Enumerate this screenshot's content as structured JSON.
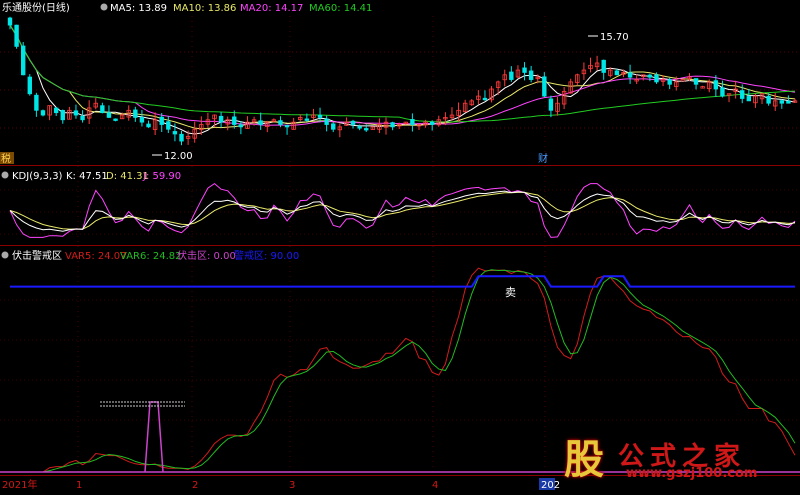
{
  "header": {
    "stock": "乐通股份(日线)",
    "ma5": "MA5: 13.89",
    "ma10": "MA10: 13.86",
    "ma20": "MA20: 14.17",
    "ma60": "MA60: 14.41"
  },
  "kdj": {
    "title": "KDJ(9,3,3)",
    "k": "K: 47.51",
    "d": "D: 41.31",
    "j": "J: 59.90"
  },
  "ambush": {
    "title": "伏击警戒区",
    "var5": "VAR5: 24.07",
    "var6": "VAR6: 24.82",
    "zone": "伏击区: 0.00",
    "alert": "警戒区: 90.00"
  },
  "markers": {
    "high": "15.70",
    "low": "12.00",
    "left_tag": "税",
    "fin_tag": "财",
    "sell": "卖"
  },
  "axis": {
    "labels": [
      "2021年",
      "1",
      "2",
      "3",
      "4",
      "202"
    ]
  },
  "watermark": {
    "glyph": "股",
    "title": "公式之家",
    "url": "www.gszj100.com"
  },
  "colors": {
    "up": "#ff3c3c",
    "down": "#00e5e5",
    "ma5": "#ffffff",
    "ma10": "#e8e86a",
    "ma20": "#ff44ff",
    "ma60": "#22cc22",
    "kdj_k": "#ffffff",
    "kdj_d": "#e8e86a",
    "kdj_j": "#ff44ff",
    "var5": "#d21c1c",
    "var6": "#22bb22",
    "zone": "#cc44cc",
    "alert": "#1a1aff"
  },
  "chart_data": [
    {
      "type": "candlestick",
      "title": "乐通股份(日线)",
      "series": [
        {
          "name": "MA5",
          "value": 13.89
        },
        {
          "name": "MA10",
          "value": 13.86
        },
        {
          "name": "MA20",
          "value": 14.17
        },
        {
          "name": "MA60",
          "value": 14.41
        }
      ],
      "annotations": [
        {
          "label": "15.70",
          "type": "high"
        },
        {
          "label": "12.00",
          "type": "low"
        }
      ],
      "close": [
        17.2,
        16.3,
        15.1,
        14.3,
        13.6,
        13.4,
        13.8,
        13.5,
        13.2,
        13.6,
        13.4,
        13.2,
        13.7,
        13.9,
        13.5,
        13.3,
        13.2,
        13.4,
        13.6,
        13.3,
        13.1,
        12.9,
        13.2,
        13.0,
        12.8,
        12.6,
        12.3,
        12.5,
        12.8,
        13.0,
        13.2,
        13.4,
        13.1,
        13.2,
        13.0,
        12.9,
        13.1,
        13.2,
        13.0,
        13.1,
        13.2,
        13.0,
        12.9,
        13.1,
        13.3,
        13.2,
        13.4,
        13.3,
        13.0,
        12.8,
        12.9,
        13.1,
        13.0,
        12.9,
        12.8,
        12.9,
        13.0,
        13.1,
        12.9,
        13.0,
        13.1,
        13.0,
        13.0,
        13.1,
        13.0,
        13.2,
        13.3,
        13.4,
        13.6,
        13.9,
        14.0,
        14.2,
        14.1,
        14.5,
        14.8,
        15.1,
        14.9,
        15.3,
        15.2,
        14.9,
        15.0,
        14.2,
        13.6,
        13.9,
        14.4,
        14.8,
        15.1,
        15.3,
        15.5,
        15.6,
        15.2,
        15.3,
        15.1,
        15.2,
        15.0,
        14.9,
        15.1,
        15.0,
        14.8,
        14.9,
        14.7,
        14.8,
        14.9,
        15.0,
        14.7,
        14.6,
        14.8,
        14.5,
        14.2,
        14.3,
        14.5,
        14.1,
        14.0,
        14.2,
        14.3,
        13.9,
        14.0,
        13.9,
        13.9,
        14.0
      ]
    },
    {
      "type": "line",
      "title": "KDJ(9,3,3)",
      "series": [
        {
          "name": "K",
          "last": 47.51
        },
        {
          "name": "D",
          "last": 41.31
        },
        {
          "name": "J",
          "last": 59.9
        }
      ]
    },
    {
      "type": "line",
      "title": "伏击警戒区",
      "series": [
        {
          "name": "VAR5",
          "last": 24.07
        },
        {
          "name": "VAR6",
          "last": 24.82
        },
        {
          "name": "伏击区",
          "last": 0.0
        },
        {
          "name": "警戒区",
          "last": 90.0
        }
      ],
      "x_labels": [
        "2021年",
        "1",
        "2",
        "3",
        "4",
        "202"
      ]
    }
  ]
}
